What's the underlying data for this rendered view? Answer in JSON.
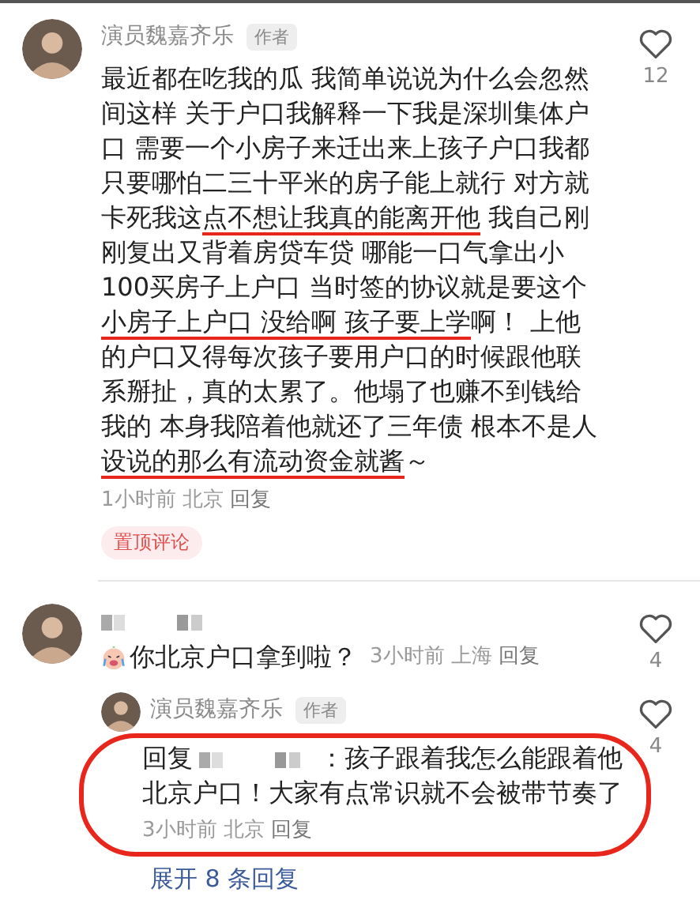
{
  "comments": [
    {
      "author": "演员魏嘉齐乐",
      "badge": "作者",
      "body_parts": [
        {
          "text": "最近都在吃我的瓜 我简单说说为什么会忽然间这样 关于户口我解释一下我是深圳集体户口 需要一个小房子来迁出来上孩子户口我都只要哪怕二三十平米的房子能上就行 对方就卡死我这",
          "marked": false
        },
        {
          "text": "点不想让我真的能离开他",
          "marked": true
        },
        {
          "text": " 我自己刚刚复出又背着房贷车贷 哪能一口气拿出小100买房子上户口 当时签的协议就是要这个",
          "marked": false
        },
        {
          "text": "小房子上户口 没给啊 孩子要上学",
          "marked": true
        },
        {
          "text": "啊！ 上他的户口又得每次孩子要用户口的时候跟他联系掰扯，真的太累了。他塌了也赚不到钱给我的 本身我陪着他就还了三年债 根本不是人",
          "marked": false
        },
        {
          "text": "设说的那么有流动资金就酱",
          "marked": true
        },
        {
          "text": "～",
          "marked": false
        }
      ],
      "time": "1小时前",
      "location": "北京",
      "reply_label": "回复",
      "likes": "12",
      "pinned": "置顶评论"
    },
    {
      "body": "你北京户口拿到啦？",
      "time": "3小时前",
      "location": "上海",
      "reply_label": "回复",
      "likes": "4",
      "children": [
        {
          "author": "演员魏嘉齐乐",
          "badge": "作者",
          "reply_prefix": "回复",
          "body": "：孩子跟着我怎么能跟着他北京户口！大家有点常识就不会被带节奏了",
          "time": "3小时前",
          "location": "北京",
          "reply_label": "回复",
          "likes": "4",
          "circled": true
        }
      ],
      "expand": "展开 8 条回复"
    }
  ]
}
